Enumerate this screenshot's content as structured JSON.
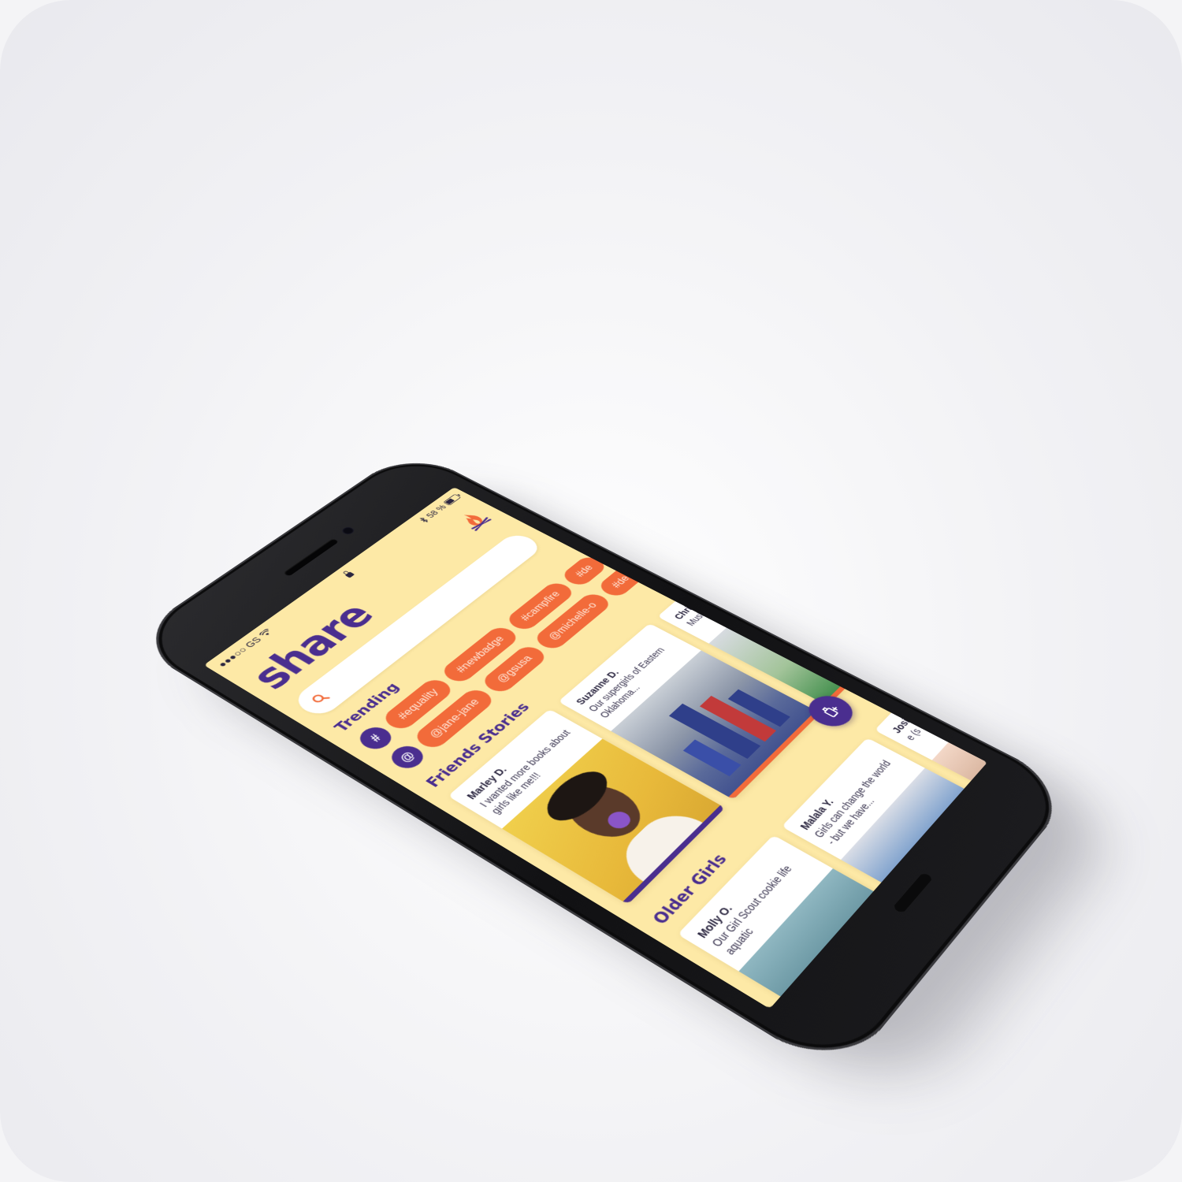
{
  "status_bar": {
    "carrier": "●●●○○ GS",
    "battery_percent": "58 %",
    "battery_level": 0.58
  },
  "header": {
    "title": "share",
    "logo_icon": "campfire-logo-icon"
  },
  "search": {
    "placeholder": "",
    "value": "",
    "icon": "search-icon"
  },
  "trending": {
    "title": "Trending",
    "hashtag_button": "#",
    "mention_button": "@",
    "hashtags": [
      "#equality",
      "#newbadge",
      "#campfire",
      "#de"
    ],
    "mentions": [
      "@jane-jane",
      "@gsusa",
      "@michelle-o",
      "#de"
    ]
  },
  "friends_stories": {
    "title": "Friends Stories",
    "stories": [
      {
        "author": "Marley D.",
        "caption": "I wanted more books about girls like me!!!"
      },
      {
        "author": "Suzanne D.",
        "caption": "Our supergirls of Eastern Oklahoma..."
      },
      {
        "author": "Chris",
        "caption": "Musli share"
      }
    ]
  },
  "older_girls": {
    "title": "Older Girls",
    "stories": [
      {
        "author": "Molly O.",
        "caption": "Our Girl Scout cookie life aquatic"
      },
      {
        "author": "Malala Y.",
        "caption": "Girls can change the world - but we have..."
      },
      {
        "author": "Josie",
        "caption": "e (s adver"
      }
    ]
  },
  "fab": {
    "icon": "new-post-icon"
  },
  "colors": {
    "background": "#fde9a6",
    "primary": "#4a2e8f",
    "accent": "#f26b3a"
  }
}
